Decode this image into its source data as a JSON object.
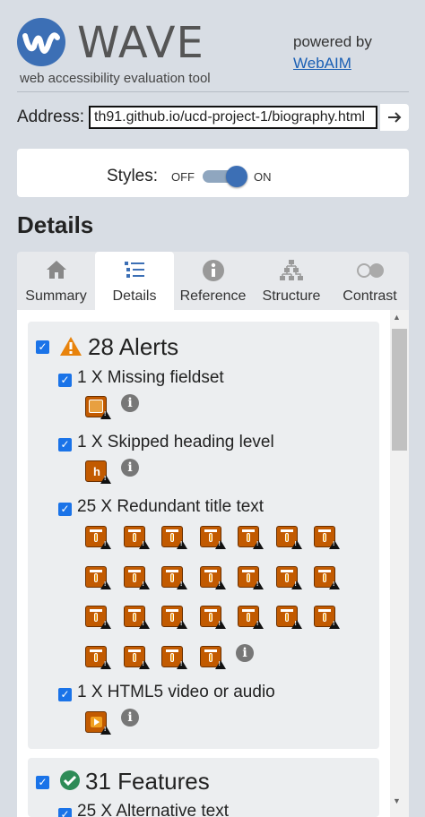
{
  "header": {
    "logo_text": "WAVE",
    "tagline": "web accessibility evaluation tool",
    "powered_by": "powered by",
    "webaim_link": "WebAIM"
  },
  "address": {
    "label": "Address:",
    "value": "th91.github.io/ucd-project-1/biography.html",
    "go_icon": "arrow-right-icon"
  },
  "styles": {
    "label": "Styles:",
    "off": "OFF",
    "on": "ON",
    "state": "on"
  },
  "details_heading": "Details",
  "tabs": [
    {
      "label": "Summary",
      "icon": "home-icon",
      "active": false
    },
    {
      "label": "Details",
      "icon": "list-icon",
      "active": true
    },
    {
      "label": "Reference",
      "icon": "info-icon",
      "active": false
    },
    {
      "label": "Structure",
      "icon": "hierarchy-icon",
      "active": false
    },
    {
      "label": "Contrast",
      "icon": "contrast-icon",
      "active": false
    }
  ],
  "alerts": {
    "title": "28 Alerts",
    "items": [
      {
        "label": "1 X Missing fieldset",
        "count": 1,
        "icon": "missing-fieldset-icon"
      },
      {
        "label": "1 X Skipped heading level",
        "count": 1,
        "icon": "skipped-heading-icon"
      },
      {
        "label": "25 X Redundant title text",
        "count": 25,
        "icon": "redundant-title-icon"
      },
      {
        "label": "1 X HTML5 video or audio",
        "count": 1,
        "icon": "html5-video-icon"
      }
    ]
  },
  "features": {
    "title": "31 Features",
    "items": [
      {
        "label": "25 X Alternative text"
      }
    ]
  },
  "colors": {
    "accent": "#3c6fb5",
    "alert_icon": "#c25a00",
    "warning_triangle": "#e8830c",
    "feature_check": "#2e8b57"
  }
}
